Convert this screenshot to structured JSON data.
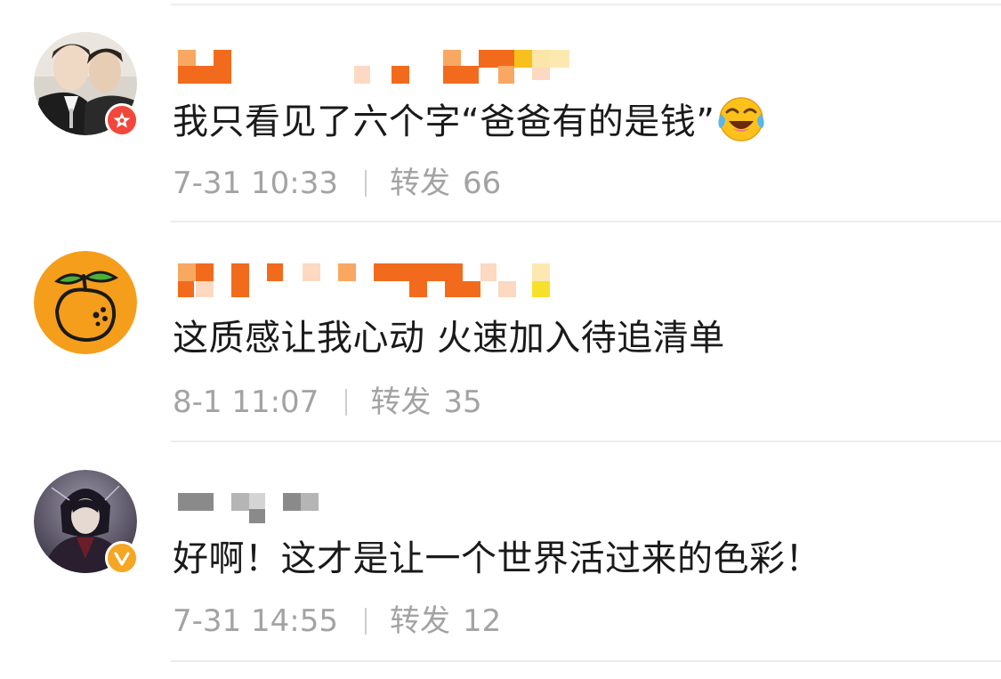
{
  "comments": [
    {
      "text": "我只看见了六个字“爸爸有的是钱”",
      "time": "7-31 10:33",
      "repost_label": "转发",
      "repost_count": "66",
      "badge": "red-star-icon",
      "emoji": "laugh-cry-emoji-icon",
      "username_colors": [
        "#f26b1d",
        "#f9a861",
        "#fcd9c0",
        "#fbe5a8",
        "#f7e02b"
      ]
    },
    {
      "text": "这质感让我心动 火速加入待追清单",
      "time": "8-1 11:07",
      "repost_label": "转发",
      "repost_count": "35",
      "badge": "",
      "username_colors": [
        "#f26b1d",
        "#f9a861",
        "#fcd9c0",
        "#fbe5a8",
        "#f7e02b"
      ]
    },
    {
      "text": "好啊！这才是让一个世界活过来的色彩！",
      "time": "7-31 14:55",
      "repost_label": "转发",
      "repost_count": "12",
      "badge": "gold-verified-icon",
      "username_colors": [
        "#8a8a8a",
        "#b5b5b5",
        "#d4d4d4"
      ]
    }
  ],
  "colors": {
    "text": "#1a1a1a",
    "meta": "#a3a3a3",
    "divider": "#ececec",
    "badge_red": "#f2473a",
    "badge_gold": "#f5a623",
    "orange_avatar": "#f59e1c"
  }
}
